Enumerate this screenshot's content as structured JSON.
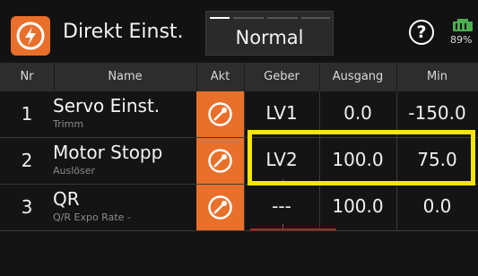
{
  "header": {
    "title": "Direkt Einst.",
    "mode": "Normal",
    "help_symbol": "?",
    "battery_pct": "89%",
    "logo_icon": "graupner-logo-icon"
  },
  "table": {
    "columns": [
      "Nr",
      "Name",
      "Akt",
      "Geber",
      "Ausgang",
      "Min"
    ],
    "rows": [
      {
        "nr": "1",
        "name": "Servo Einst.",
        "sub": "Trimm",
        "geber": "LV1",
        "ausgang": "0.0",
        "min": "-150.0"
      },
      {
        "nr": "2",
        "name": "Motor Stopp",
        "sub": "Auslöser",
        "geber": "LV2",
        "ausgang": "100.0",
        "min": "75.0"
      },
      {
        "nr": "3",
        "name": "QR",
        "sub": "Q/R Expo Rate -",
        "geber": "---",
        "ausgang": "100.0",
        "min": "0.0"
      }
    ]
  },
  "colors": {
    "accent": "#e8702a",
    "highlight": "#f6e600",
    "battery": "#4caf50"
  }
}
